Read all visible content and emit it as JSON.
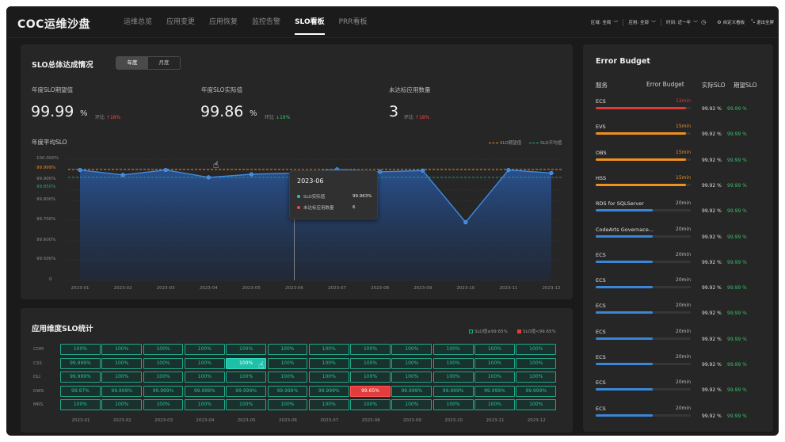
{
  "app_title": "COC运维沙盘",
  "nav": [
    "运维总览",
    "应用变更",
    "应用恢复",
    "监控告警",
    "SLO看板",
    "PRR看板"
  ],
  "nav_active_index": 4,
  "filters": {
    "region": "区域: 全局",
    "app": "应用: 全部",
    "time": "时间: 近一年",
    "custom_board": "自定义看板",
    "exit_fullscreen": "退出全屏"
  },
  "overall": {
    "title": "SLO总体达成情况",
    "toggle": [
      "年度",
      "月度"
    ],
    "toggle_active": 0,
    "kpis": [
      {
        "label": "年度SLO期望值",
        "value": "99.99",
        "unit": "%",
        "cmp_label": "环比",
        "cmp_arrow": "↑",
        "cmp_value": "18%",
        "trend": "up"
      },
      {
        "label": "年度SLO实际值",
        "value": "99.86",
        "unit": "%",
        "cmp_label": "环比",
        "cmp_arrow": "↓",
        "cmp_value": "19%",
        "trend": "down"
      },
      {
        "label": "未达标应用数量",
        "value": "3",
        "unit": "",
        "cmp_label": "环比",
        "cmp_arrow": "↑",
        "cmp_value": "18%",
        "trend": "up"
      }
    ]
  },
  "chart_data": {
    "type": "line",
    "title": "年度平均SLO",
    "x": [
      "2023-01",
      "2023-02",
      "2023-03",
      "2023-04",
      "2023-05",
      "2023-06",
      "2023-07",
      "2023-08",
      "2023-09",
      "2023-10",
      "2023-11",
      "2023-12"
    ],
    "series": [
      {
        "name": "SLO实际值",
        "values": [
          99.98,
          99.94,
          99.98,
          99.92,
          99.945,
          99.955,
          99.985,
          99.965,
          99.975,
          99.69,
          99.98,
          99.955
        ]
      }
    ],
    "reference_lines": [
      {
        "name": "SLO期望值",
        "value": 99.99,
        "color": "#e8891f"
      },
      {
        "name": "SLO平均值",
        "value": 99.86,
        "color": "#1fa88a"
      }
    ],
    "y_ticks": [
      "0",
      "99.500%",
      "99.600%",
      "99.700%",
      "99.800%",
      "99.850%",
      "99.900%",
      "99.999%",
      "100.000%"
    ],
    "legend": [
      "SLO期望值",
      "SLO平均值"
    ],
    "legend_position": "top-right",
    "tooltip": {
      "title": "2023-06",
      "rows": [
        {
          "label": "SLO实际值",
          "value": "99.963%",
          "color": "#26c6b0"
        },
        {
          "label": "未达标应用数量",
          "value": "6",
          "color": "#e84a4a"
        }
      ]
    }
  },
  "heatmap": {
    "title": "应用维度SLO统计",
    "legend": [
      "SLO值≥99.65%",
      "SLO值<99.65%"
    ],
    "rows": [
      {
        "label": "CDM",
        "values": [
          "100%",
          "100%",
          "100%",
          "100%",
          "100%",
          "100%",
          "100%",
          "100%",
          "100%",
          "100%",
          "100%",
          "100%"
        ]
      },
      {
        "label": "CSS",
        "values": [
          "99.999%",
          "100%",
          "100%",
          "100%",
          "100%",
          "100%",
          "100%",
          "100%",
          "100%",
          "100%",
          "100%",
          "100%"
        ]
      },
      {
        "label": "DLI",
        "values": [
          "99.999%",
          "100%",
          "100%",
          "100%",
          "100%",
          "100%",
          "100%",
          "100%",
          "100%",
          "100%",
          "100%",
          "100%"
        ]
      },
      {
        "label": "DWS",
        "values": [
          "99.97%",
          "99.999%",
          "99.999%",
          "99.999%",
          "99.999%",
          "99.999%",
          "99.999%",
          "99.65%",
          "99.999%",
          "99.999%",
          "99.999%",
          "99.999%"
        ]
      },
      {
        "label": "MRS",
        "values": [
          "100%",
          "100%",
          "100%",
          "100%",
          "100%",
          "100%",
          "100%",
          "100%",
          "100%",
          "100%",
          "100%",
          "100%"
        ]
      }
    ],
    "columns": [
      "2023-01",
      "2023-02",
      "2023-03",
      "2023-04",
      "2023-05",
      "2023-06",
      "2023-07",
      "2023-08",
      "2023-09",
      "2023-10",
      "2023-11",
      "2023-12"
    ],
    "selected": {
      "row": 1,
      "col": 4
    },
    "bad": {
      "row": 3,
      "col": 7
    }
  },
  "error_budget": {
    "title": "Error Budget",
    "headers": [
      "服务",
      "Error Budget",
      "实际SLO",
      "期望SLO"
    ],
    "rows": [
      {
        "service": "ECS",
        "budget": "12min",
        "fill": 0.95,
        "color": "#e03a3a",
        "actual": "99.92 %",
        "expected": "99.99 %"
      },
      {
        "service": "EVS",
        "budget": "15min",
        "fill": 0.95,
        "color": "#f0901e",
        "actual": "99.92 %",
        "expected": "99.99 %"
      },
      {
        "service": "OBS",
        "budget": "15min",
        "fill": 0.95,
        "color": "#f0901e",
        "actual": "99.92 %",
        "expected": "99.99 %"
      },
      {
        "service": "HSS",
        "budget": "15min",
        "fill": 0.95,
        "color": "#f0901e",
        "actual": "99.92 %",
        "expected": "99.99 %"
      },
      {
        "service": "RDS for SQLServer",
        "budget": "20min",
        "fill": 0.6,
        "color": "#3a86d8",
        "actual": "99.92 %",
        "expected": "99.99 %"
      },
      {
        "service": "CodeArts Governace...",
        "budget": "20min",
        "fill": 0.6,
        "color": "#3a86d8",
        "actual": "99.92 %",
        "expected": "99.99 %"
      },
      {
        "service": "ECS",
        "budget": "20min",
        "fill": 0.6,
        "color": "#3a86d8",
        "actual": "99.92 %",
        "expected": "99.99 %"
      },
      {
        "service": "ECS",
        "budget": "20min",
        "fill": 0.6,
        "color": "#3a86d8",
        "actual": "99.92 %",
        "expected": "99.99 %"
      },
      {
        "service": "ECS",
        "budget": "20min",
        "fill": 0.6,
        "color": "#3a86d8",
        "actual": "99.92 %",
        "expected": "99.99 %"
      },
      {
        "service": "ECS",
        "budget": "20min",
        "fill": 0.6,
        "color": "#3a86d8",
        "actual": "99.92 %",
        "expected": "99.99 %"
      },
      {
        "service": "ECS",
        "budget": "20min",
        "fill": 0.6,
        "color": "#3a86d8",
        "actual": "99.92 %",
        "expected": "99.99 %"
      },
      {
        "service": "ECS",
        "budget": "20min",
        "fill": 0.6,
        "color": "#3a86d8",
        "actual": "99.92 %",
        "expected": "99.99 %"
      },
      {
        "service": "ECS",
        "budget": "20min",
        "fill": 0.6,
        "color": "#3a86d8",
        "actual": "99.92 %",
        "expected": "99.99 %"
      }
    ]
  }
}
